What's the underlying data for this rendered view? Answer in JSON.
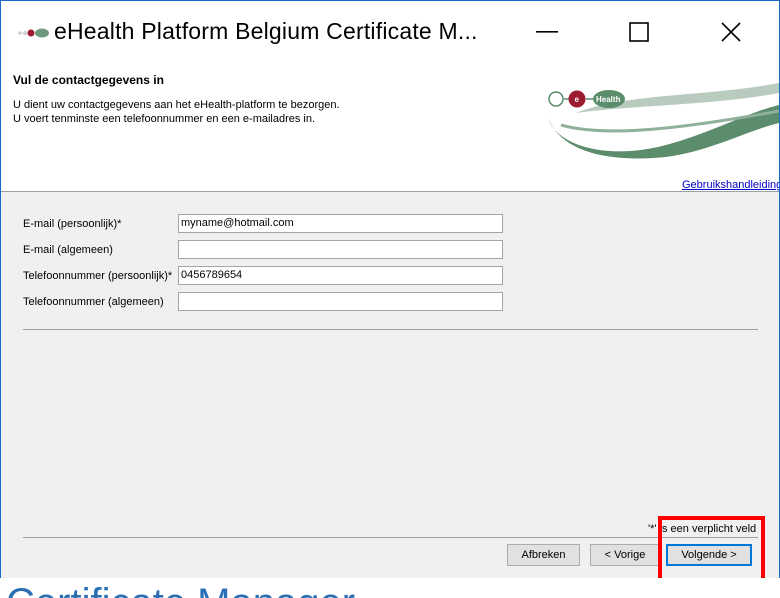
{
  "window": {
    "title": "eHealth Platform Belgium Certificate M...",
    "controls": {
      "minimize": "minimize-icon",
      "maximize": "maximize-icon",
      "close": "close-icon"
    }
  },
  "header": {
    "title": "Vul de contactgegevens in",
    "desc_line1": "U dient uw contactgegevens aan het eHealth-platform te bezorgen.",
    "desc_line2": "U voert tenminste een telefoonnummer en een e-mailadres in.",
    "logo_text": "Health",
    "logo_letter": "e",
    "help_link": "Gebruikshandleiding"
  },
  "form": {
    "fields": [
      {
        "label": "E-mail (persoonlijk)*",
        "value": "myname@hotmail.com"
      },
      {
        "label": "E-mail (algemeen)",
        "value": ""
      },
      {
        "label": "Telefoonnummer (persoonlijk)*",
        "value": "0456789654"
      },
      {
        "label": "Telefoonnummer (algemeen)",
        "value": ""
      }
    ]
  },
  "footer": {
    "required_note": "'*' is een verplicht veld",
    "cancel_label": "Afbreken",
    "prev_label": "< Vorige",
    "next_label": "Volgende >"
  },
  "background": {
    "text": "Certificate Manager"
  },
  "colors": {
    "accent": "#0078d7",
    "highlight": "#ff0000",
    "logo_green": "#5b8c6b",
    "logo_red": "#9b1b30",
    "link": "#0000cc"
  }
}
